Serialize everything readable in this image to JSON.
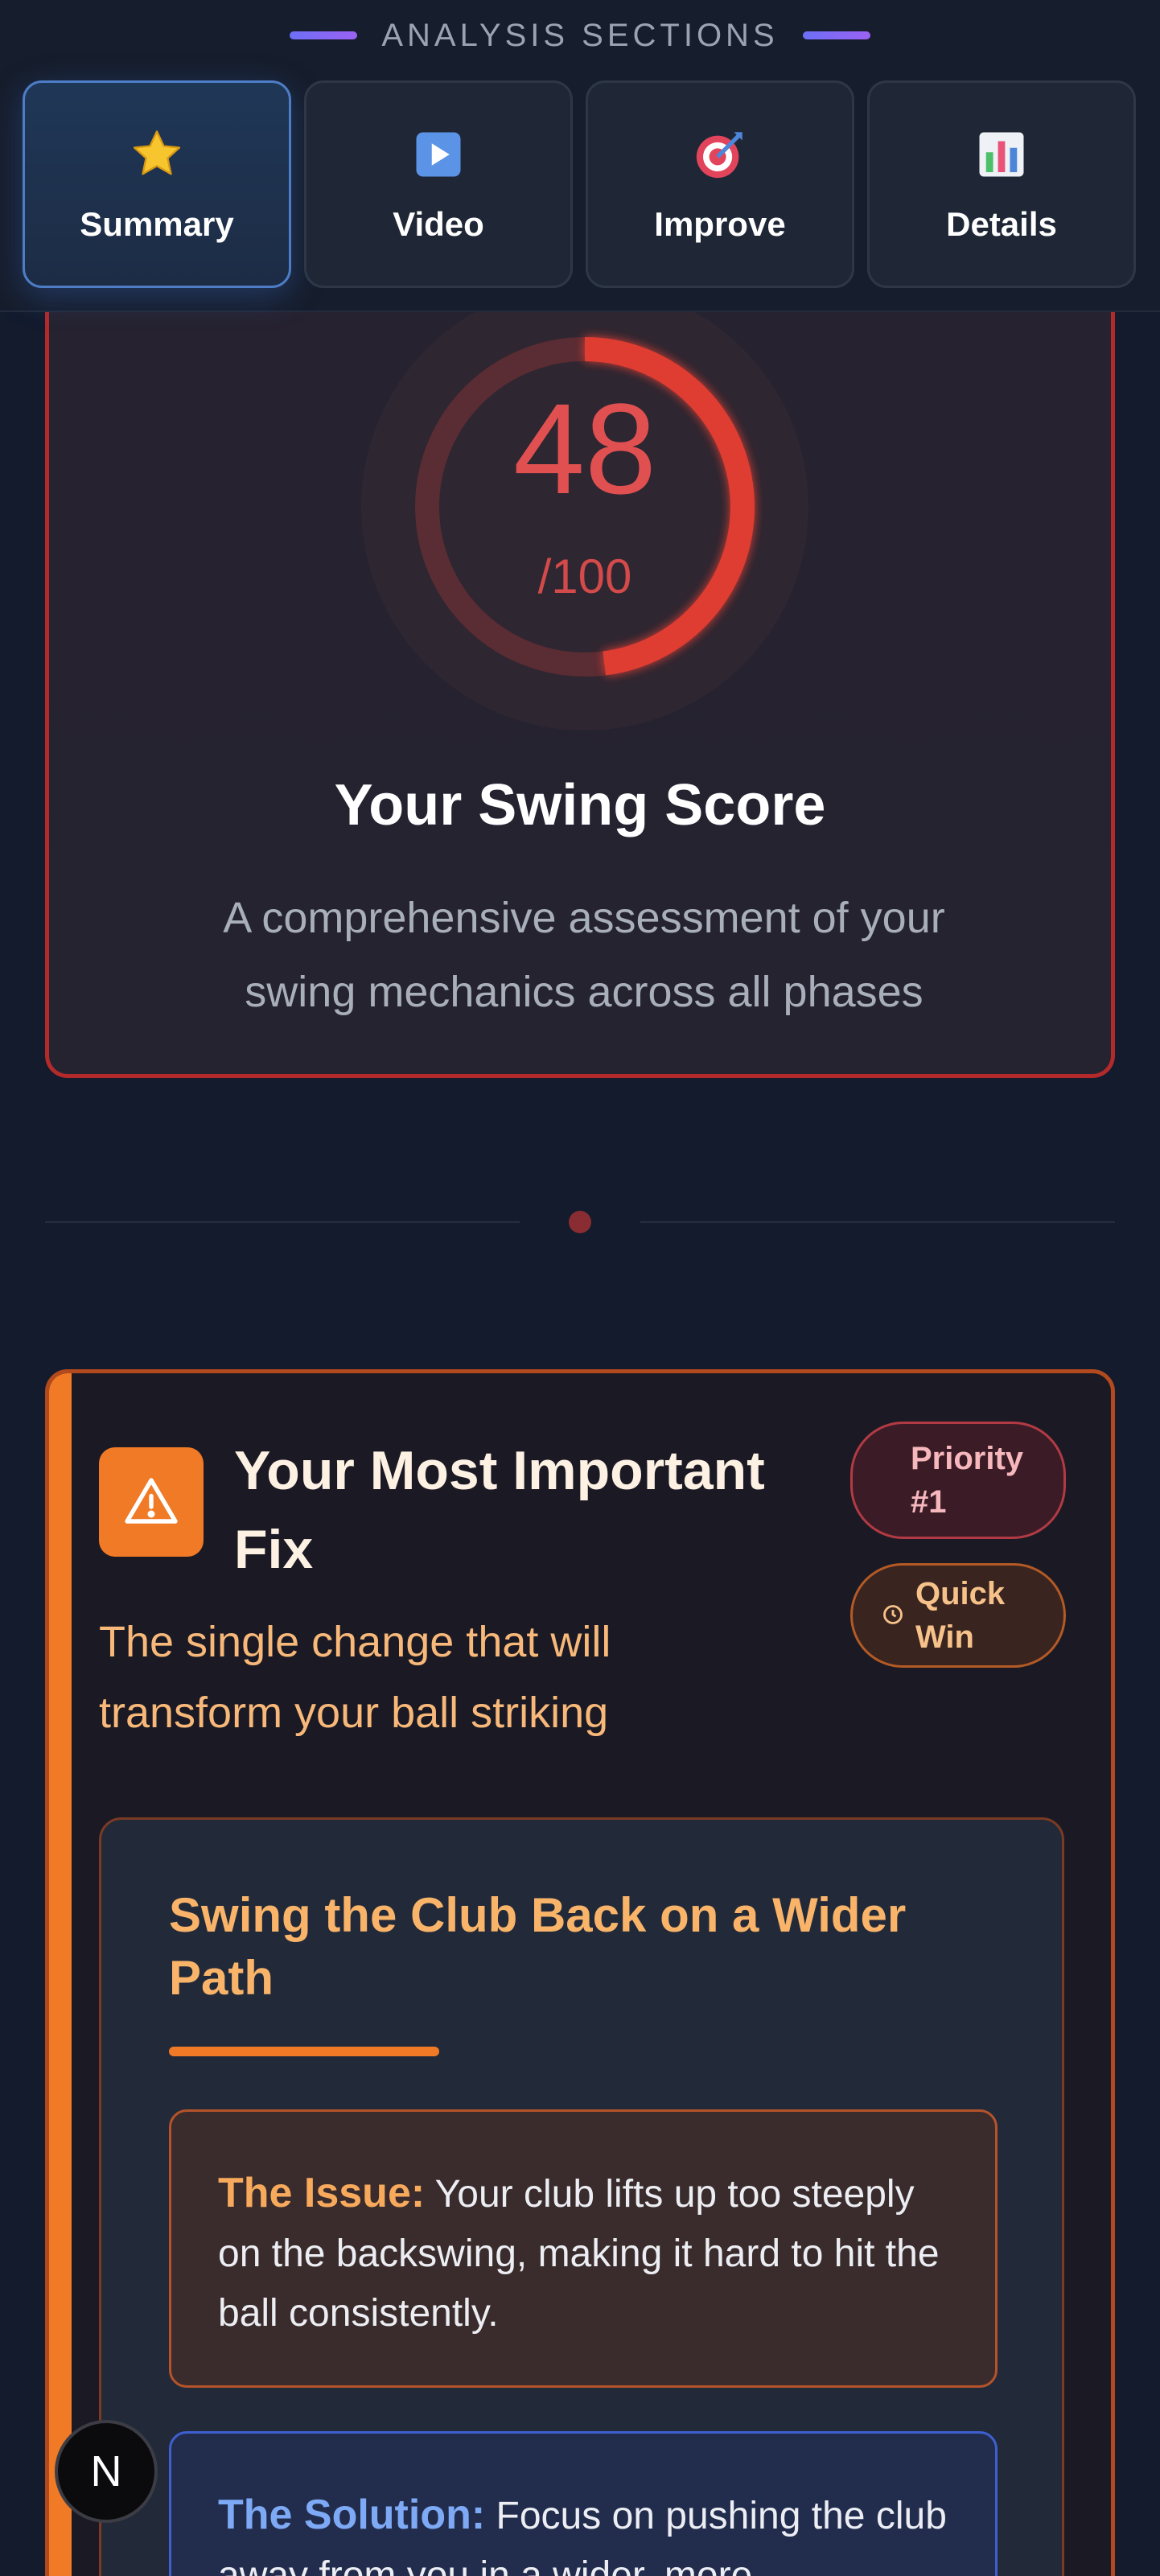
{
  "nav": {
    "heading": "ANALYSIS SECTIONS",
    "tabs": [
      {
        "label": "Summary",
        "icon": "star-icon",
        "active": true
      },
      {
        "label": "Video",
        "icon": "play-icon",
        "active": false
      },
      {
        "label": "Improve",
        "icon": "target-icon",
        "active": false
      },
      {
        "label": "Details",
        "icon": "bar-chart-icon",
        "active": false
      }
    ]
  },
  "score": {
    "value": "48",
    "max": "/100",
    "progress": 0.48,
    "title": "Your Swing Score",
    "description": "A comprehensive assessment of your swing mechanics across all phases",
    "color": "#e03c33"
  },
  "fix": {
    "title": "Your Most Important Fix",
    "subtitle": "The single change that will transform your ball striking",
    "priority_badge": "Priority #1",
    "quick_badge": "Quick Win",
    "item_title": "Swing the Club Back on a Wider Path",
    "issue_label": "The Issue:",
    "issue_text": "Your club lifts up too steeply on the backswing, making it hard to hit the ball consistently.",
    "solution_label": "The Solution:",
    "solution_text": "Focus on pushing the club away from you in a wider, more",
    "accent_color": "#f07a26"
  },
  "badge": {
    "label": "N"
  }
}
